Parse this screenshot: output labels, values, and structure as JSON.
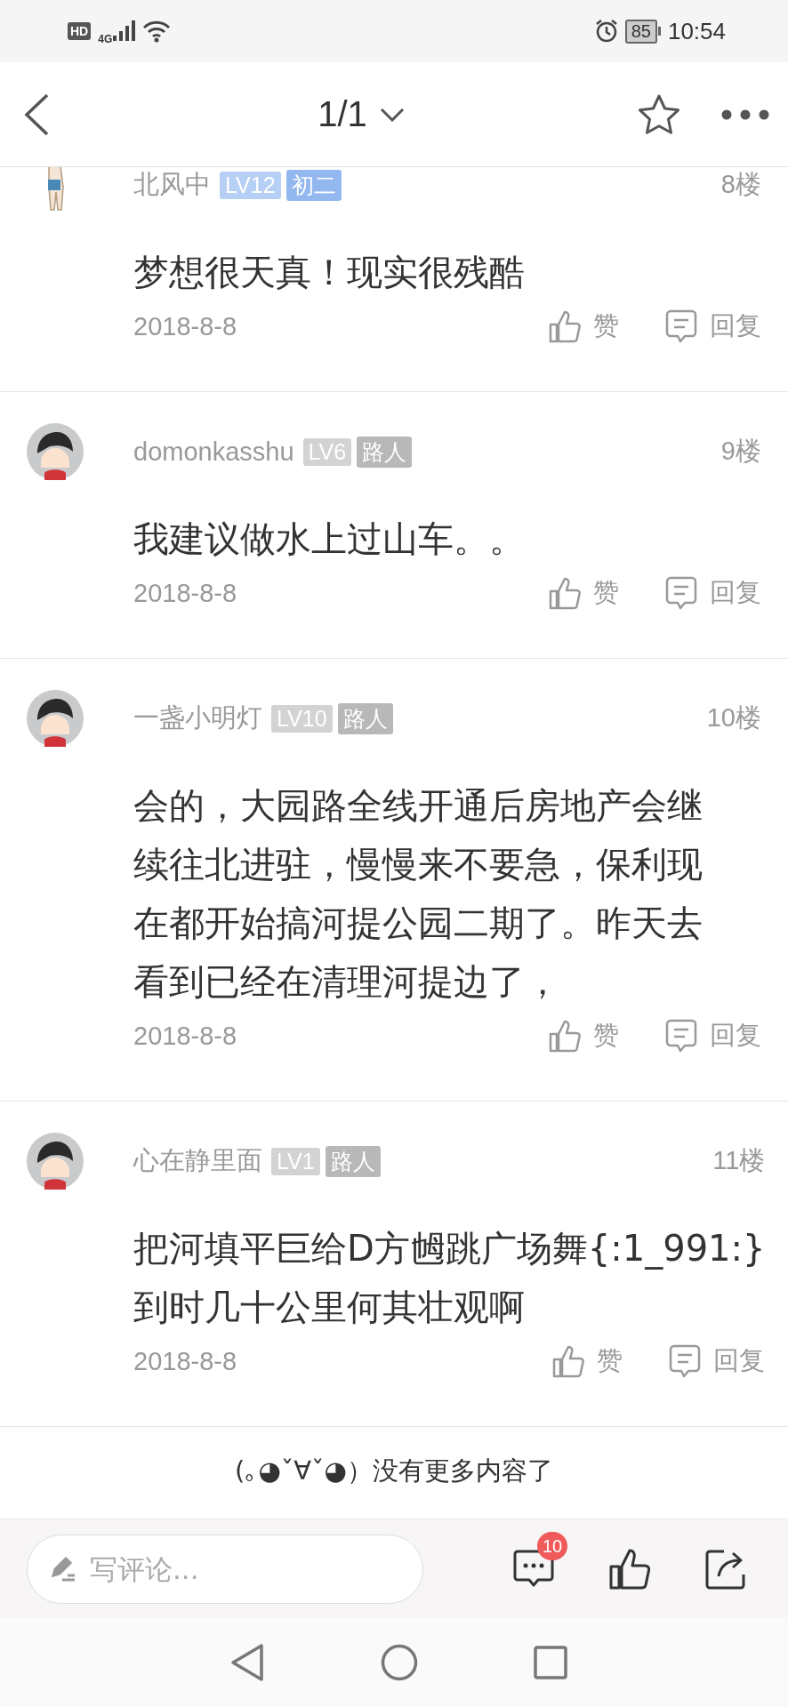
{
  "status_bar": {
    "hd": "HD",
    "network": "4G",
    "battery": "85",
    "time": "10:54"
  },
  "header": {
    "title": "1/1"
  },
  "comments": [
    {
      "user": "北风中",
      "badges": [
        {
          "text": "LV12",
          "color": "#b6cff5"
        },
        {
          "text": "初二",
          "color": "#93b7ef"
        }
      ],
      "floor": "8楼",
      "content": [
        "梦想很天真！现实很残酷"
      ],
      "date": "2018-8-8",
      "like": "赞",
      "reply": "回复",
      "kind": "figure"
    },
    {
      "user": "domonkasshu",
      "badges": [
        {
          "text": "LV6",
          "color": "#d3d3d3"
        },
        {
          "text": "路人",
          "color": "#b8b8b8"
        }
      ],
      "floor": "9楼",
      "content": [
        "我建议做水上过山车。。"
      ],
      "date": "2018-8-8",
      "like": "赞",
      "reply": "回复",
      "kind": "kid"
    },
    {
      "user": "一盏小明灯",
      "badges": [
        {
          "text": "LV10",
          "color": "#d3d3d3"
        },
        {
          "text": "路人",
          "color": "#b8b8b8"
        }
      ],
      "floor": "10楼",
      "content": [
        "会的，大园路全线开通后房地产会继",
        "续往北进驻，慢慢来不要急，保利现",
        "在都开始搞河提公园二期了。昨天去",
        "看到已经在清理河提边了，"
      ],
      "date": "2018-8-8",
      "like": "赞",
      "reply": "回复",
      "kind": "kid"
    },
    {
      "user": "心在静里面",
      "badges": [
        {
          "text": "LV1",
          "color": "#d3d3d3"
        },
        {
          "text": "路人",
          "color": "#b8b8b8"
        }
      ],
      "floor": "11楼",
      "content": [
        "把河填平巨给D方乸跳广场舞{:1_991:}",
        "到时几十公里何其壮观啊"
      ],
      "date": "2018-8-8",
      "like": "赞",
      "reply": "回复",
      "kind": "kid"
    }
  ],
  "end_note": "(｡◕ˇ∀ˇ◕）没有更多内容了",
  "comment_bar": {
    "placeholder": "写评论...",
    "comment_count": "10"
  }
}
